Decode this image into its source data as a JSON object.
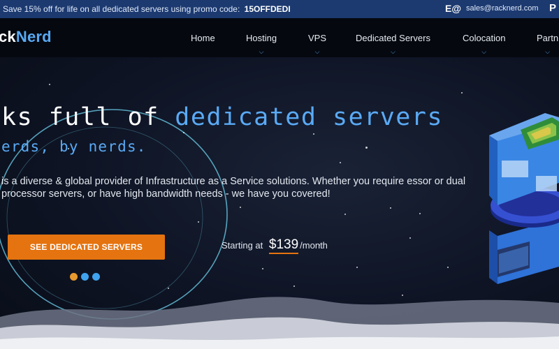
{
  "topbar": {
    "promo_text": "Save 15% off for life on all dedicated servers using promo code:",
    "promo_code": "15OFFDEDI",
    "email_icon": "E@",
    "email": "sales@racknerd.com",
    "phone_icon": "P"
  },
  "nav": {
    "logo_part1": "ck",
    "logo_part2": "Nerd",
    "items": [
      {
        "label": "Home",
        "has_dropdown": false
      },
      {
        "label": "Hosting",
        "has_dropdown": true
      },
      {
        "label": "VPS",
        "has_dropdown": true
      },
      {
        "label": "Dedicated Servers",
        "has_dropdown": true
      },
      {
        "label": "Colocation",
        "has_dropdown": true
      },
      {
        "label": "Partn",
        "has_dropdown": true
      }
    ],
    "chevron_icon": "chevron-down-icon"
  },
  "hero": {
    "headline_prefix": "ks full of ",
    "headline_highlight": "dedicated servers",
    "subline": "erds, by nerds.",
    "description": "is a diverse & global provider of Infrastructure as a Service solutions. Whether you require essor or dual processor servers, or have high bandwidth needs - we have you covered!",
    "cta_label": "SEE DEDICATED SERVERS",
    "price_prefix": "Starting at",
    "price_amount": "$139",
    "price_suffix": "/month",
    "carousel_dots": 3,
    "carousel_active": 0
  },
  "colors": {
    "topbar_bg": "#1c3a70",
    "nav_bg": "#05080f",
    "accent_blue": "#5aaaf5",
    "accent_orange": "#e5730f",
    "dot_active": "#e89a2e",
    "dot_inactive": "#3fa3ee"
  }
}
